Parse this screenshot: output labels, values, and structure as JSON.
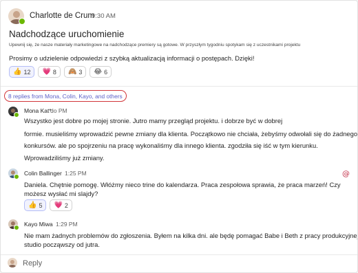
{
  "post": {
    "author": "Charlotte de Crum",
    "time": "9:30 AM",
    "title": "Nadchodzące uruchomienie",
    "small_text": "Upewnij się, że nasze materiały marketingowe na nadchodzące premiery są gotowe. W przyszłym tygodniu spotykam się z uczestnikami projektu",
    "body": "Prosimy o udzielenie odpowiedzi z szybką aktualizacją informacji o postępach. Dzięki!",
    "reactions": [
      {
        "emoji": "👍",
        "count": "12",
        "icon": "thumbs-up-icon"
      },
      {
        "emoji": "💗",
        "count": "8",
        "icon": "heart-icon"
      },
      {
        "emoji": "🙈",
        "count": "3",
        "icon": "see-no-evil-icon"
      },
      {
        "emoji": "😂",
        "count": "6",
        "icon": "laughing-icon"
      }
    ]
  },
  "thread": {
    "replies_link": "8 replies from Mona, Colin, Kayo, and others"
  },
  "replies": [
    {
      "author": "Mona Kat*",
      "time": "do PM",
      "lines": [
        "Wszystko jest dobre po mojej stronie. Jutro mamy przegląd projektu. i dobrze być w dobrej",
        "formie. musieliśmy wprowadzić pewne zmiany dla klienta. Początkowo nie chciała, żebyśmy odwołali się do żadnego z",
        "konkursów. ale po spojrzeniu na pracę wykonaliśmy dla innego klienta. zgodziła się iść w tym kierunku.",
        "Wprowadziliśmy już zmiany."
      ]
    },
    {
      "author": "Colin Ballinger",
      "time": "1:25 PM",
      "lines": [
        "Daniela. Chętnie pomogę. Włóżmy nieco trine do kalendarza. Praca zespołowa sprawia, że praca marzeń! Czy",
        "możesz wysłać mi slajdy?"
      ],
      "reactions": [
        {
          "emoji": "👍",
          "count": "5",
          "icon": "thumbs-up-icon"
        },
        {
          "emoji": "💗",
          "count": "2",
          "icon": "heart-icon"
        }
      ],
      "mention_icon": "@"
    },
    {
      "author": "Kayo Miwa",
      "time": "1:29 PM",
      "lines": [
        "Nie mam żadnych problemów do zgłoszenia. Byłem na kilka dni. ale będę pomagać Babe i Beth z pracy produkcyjnej",
        "studio począwszy od jutra."
      ]
    }
  ],
  "composer": {
    "reply_label": "Reply"
  },
  "colors": {
    "accent": "#5b5fc7",
    "highlight_border": "#d13438",
    "presence": "#6bb700",
    "mention": "#c4314b"
  }
}
